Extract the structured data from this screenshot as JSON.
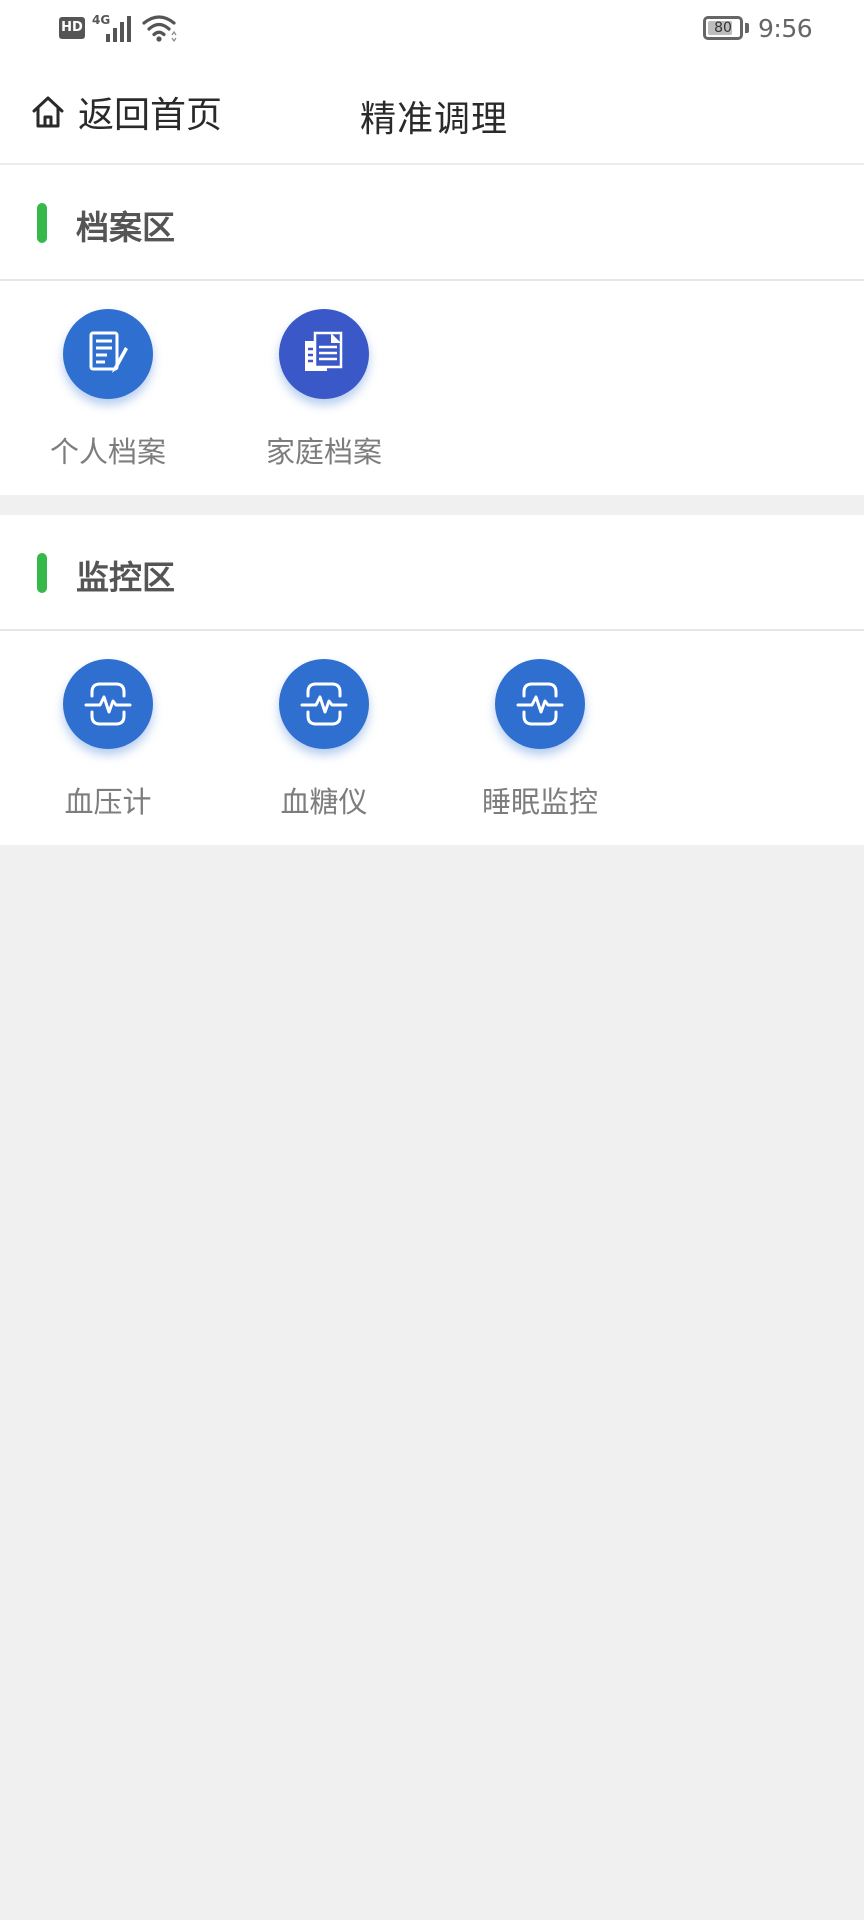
{
  "status_bar": {
    "hd_label": "HD",
    "network_label": "4G",
    "battery_level": "80",
    "battery_fraction": 0.8,
    "time": "9:56"
  },
  "nav": {
    "back_label": "返回首页",
    "title": "精准调理"
  },
  "sections": [
    {
      "title": "档案区",
      "accent_color": "#36b84a",
      "items": [
        {
          "label": "个人档案",
          "icon": "document-pen-icon"
        },
        {
          "label": "家庭档案",
          "icon": "documents-stack-icon"
        }
      ]
    },
    {
      "title": "监控区",
      "accent_color": "#36b84a",
      "items": [
        {
          "label": "血压计",
          "icon": "heart-monitor-icon"
        },
        {
          "label": "血糖仪",
          "icon": "heart-monitor-icon"
        },
        {
          "label": "睡眠监控",
          "icon": "heart-monitor-icon"
        }
      ]
    }
  ],
  "colors": {
    "icon_blue": "#2f6fd0",
    "icon_indigo": "#3b58c8",
    "accent_green": "#36b84a",
    "background": "#f0f0f0"
  }
}
